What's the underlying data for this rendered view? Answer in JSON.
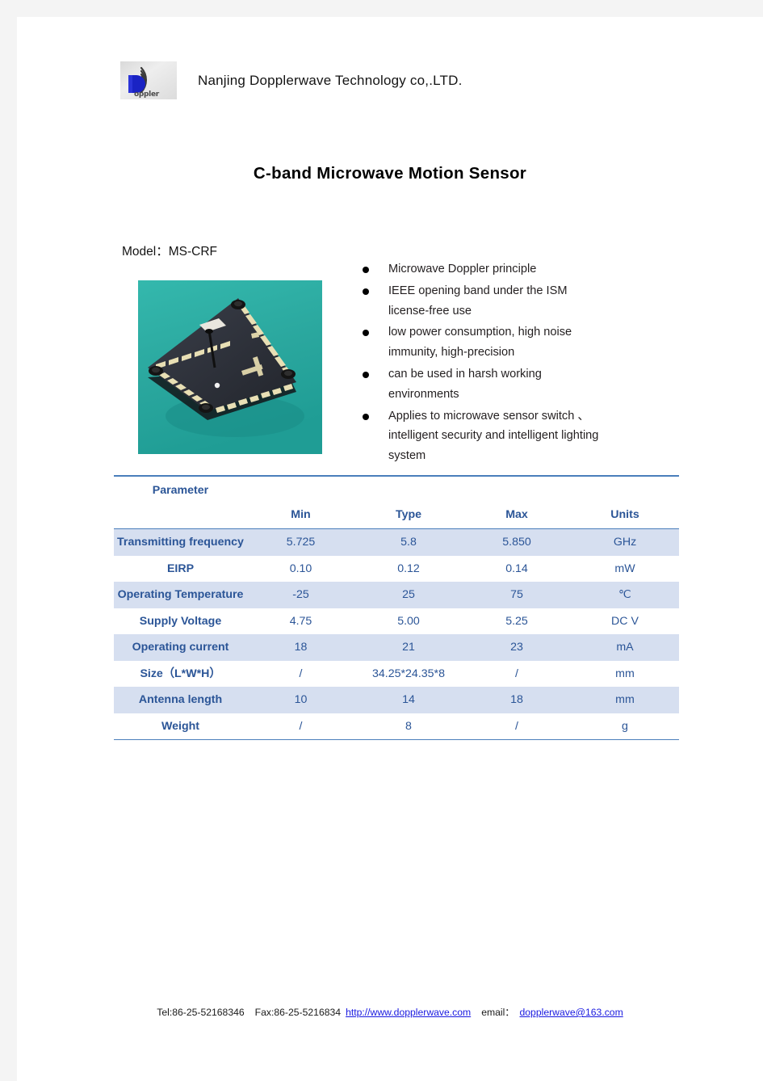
{
  "document": {
    "title": "C-band  Microwave  Motion  Sensor",
    "model_line": "Model：MS-CRF"
  },
  "header": {
    "logo_wordmark": "oppler",
    "logo_letter": "D",
    "company": "Nanjing    Dopplerwave    Technology  co,.LTD."
  },
  "features": [
    {
      "lines": [
        "Microwave  Doppler  principle"
      ]
    },
    {
      "lines": [
        "IEEE   opening   band   under   the   ISM",
        "license-free  use"
      ]
    },
    {
      "lines": [
        "low   power   consumption,   high   noise",
        "immunity,  high-precision"
      ]
    },
    {
      "lines": [
        "can    be    used    in    harsh    working",
        "environments"
      ]
    },
    {
      "lines": [
        "Applies  to  microwave  sensor  switch  、",
        "intelligent  security  and  intelligent  lighting",
        "system"
      ]
    }
  ],
  "spec_table": {
    "headers": [
      "Parameter",
      "Min",
      "Type",
      "Max",
      "Units"
    ],
    "rows": [
      {
        "parameter": "Transmitting frequency",
        "min": "5.725",
        "type": "5.8",
        "max": "5.850",
        "units": "GHz"
      },
      {
        "parameter": "EIRP",
        "min": "0.10",
        "type": "0.12",
        "max": "0.14",
        "units": "mW"
      },
      {
        "parameter": "Operating Temperature",
        "min": "-25",
        "type": "25",
        "max": "75",
        "units": "℃"
      },
      {
        "parameter": "Supply  Voltage",
        "min": "4.75",
        "type": "5.00",
        "max": "5.25",
        "units": "DC  V"
      },
      {
        "parameter": "Operating  current",
        "min": "18",
        "type": "21",
        "max": "23",
        "units": "mA"
      },
      {
        "parameter": "Size（L*W*H）",
        "min": "/",
        "type": "34.25*24.35*8",
        "max": "/",
        "units": "mm"
      },
      {
        "parameter": "Antenna  length",
        "min": "10",
        "type": "14",
        "max": "18",
        "units": "mm"
      },
      {
        "parameter": "Weight",
        "min": "/",
        "type": "8",
        "max": "/",
        "units": "g"
      }
    ]
  },
  "footer": {
    "tel": "Tel:86-25-52168346",
    "fax": "Fax:86-25-5216834",
    "website": "http://www.dopplerwave.com",
    "email_label": "email：",
    "email": "dopplerwave@163.com"
  },
  "colors": {
    "table_accent": "#4a7ebb",
    "table_text": "#2b5597",
    "table_band": "#d6dff0",
    "link": "#1a1ae0",
    "photo_background": "#2fb0a6"
  }
}
